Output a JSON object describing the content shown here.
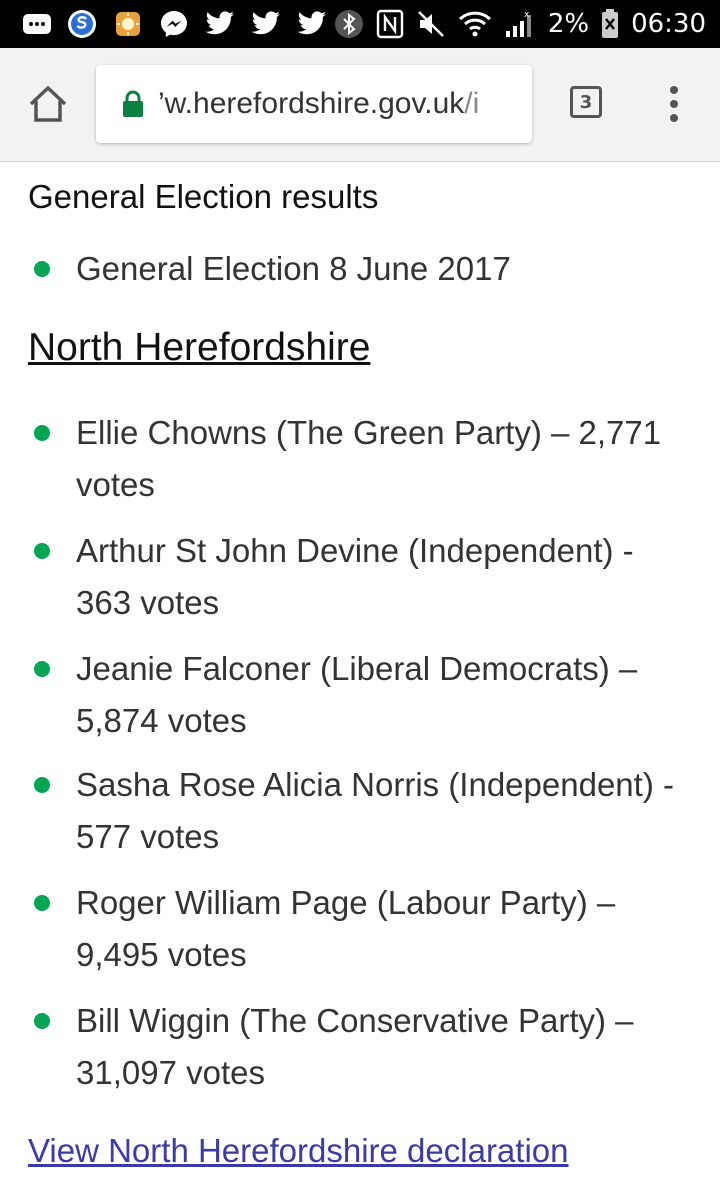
{
  "status_bar": {
    "battery_percent": "2%",
    "time": "06:30",
    "icons_left": [
      "more-icon",
      "skype-icon",
      "sun-icon",
      "messenger-icon",
      "twitter-icon",
      "twitter-icon",
      "twitter-icon"
    ],
    "icons_right": [
      "bluetooth-icon",
      "nfc-icon",
      "mute-icon",
      "wifi-icon",
      "signal-icon",
      "battery-icon"
    ]
  },
  "browser": {
    "url_main": "’w.herefordshire.gov.uk",
    "url_tail": "/i",
    "tab_count": "3",
    "lock_color": "#0b8043"
  },
  "page": {
    "section_title": "General Election results",
    "election_item": "General Election 8 June 2017",
    "region_title": "North Herefordshire",
    "candidates": [
      {
        "text": "Ellie Chowns (The Green Party) – 2,771 votes"
      },
      {
        "text": "Arthur St John Devine (Independent) - 363 votes"
      },
      {
        "text": "Jeanie Falconer (Liberal Democrats) – 5,874 votes"
      },
      {
        "text": "Sasha Rose Alicia Norris (Independent) - 577 votes"
      },
      {
        "text": "Roger William Page (Labour Party) – 9,495 votes"
      },
      {
        "text": "Bill Wiggin (The Conservative Party) – 31,097 votes"
      }
    ],
    "declaration_link": "View North Herefordshire declaration",
    "bullet_color": "#00a651",
    "link_color": "#3a3aa8"
  }
}
